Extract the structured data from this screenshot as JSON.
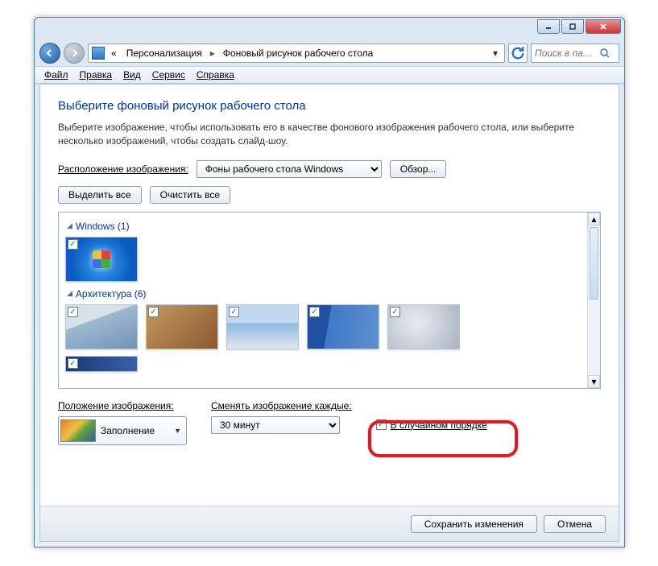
{
  "breadcrumb": {
    "prefix": "«",
    "p1": "Персонализация",
    "p2": "Фоновый рисунок рабочего стола"
  },
  "search": {
    "placeholder": "Поиск в па..."
  },
  "menu": {
    "file": "Файл",
    "edit": "Правка",
    "view": "Вид",
    "tools": "Сервис",
    "help": "Справка"
  },
  "heading": "Выберите фоновый рисунок рабочего стола",
  "sub": "Выберите изображение, чтобы использовать его в качестве фонового изображения рабочего стола, или выберите несколько изображений, чтобы создать слайд-шоу.",
  "loc_label": "Расположение изображения:",
  "loc_value": "Фоны рабочего стола Windows",
  "browse": "Обзор...",
  "select_all": "Выделить все",
  "clear_all": "Очистить все",
  "groups": {
    "g1": "Windows (1)",
    "g2": "Архитектура (6)"
  },
  "position": {
    "label": "Положение изображения:",
    "value": "Заполнение"
  },
  "interval": {
    "label": "Сменять изображение каждые:",
    "value": "30 минут"
  },
  "shuffle": {
    "label": "В случайном порядке"
  },
  "footer": {
    "save": "Сохранить изменения",
    "cancel": "Отмена"
  }
}
